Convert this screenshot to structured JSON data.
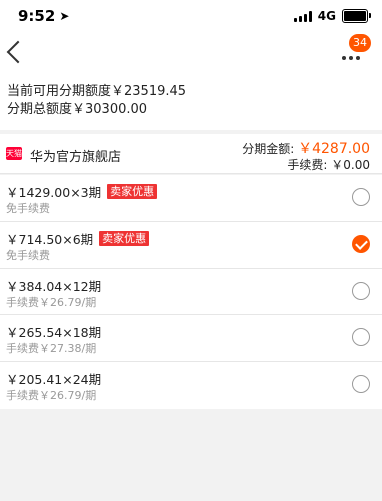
{
  "status_bar": {
    "time": "9:52",
    "network": "4G"
  },
  "nav": {
    "badge_count": "34"
  },
  "quota": {
    "available_line": "当前可用分期额度￥23519.45",
    "total_line": "分期总额度￥30300.00"
  },
  "store": {
    "logo_text": "天猫",
    "name": "华为官方旗舰店",
    "amount_label": "分期金额:",
    "amount_value": "￥4287.00",
    "fee_label": "手续费:",
    "fee_value": "￥0.00"
  },
  "plans": [
    {
      "main": "￥1429.00×3期",
      "promo": "卖家优惠",
      "sub": "免手续费",
      "selected": false
    },
    {
      "main": "￥714.50×6期",
      "promo": "卖家优惠",
      "sub": "免手续费",
      "selected": true
    },
    {
      "main": "￥384.04×12期",
      "promo": "",
      "sub": "手续费￥26.79/期",
      "selected": false
    },
    {
      "main": "￥265.54×18期",
      "promo": "",
      "sub": "手续费￥27.38/期",
      "selected": false
    },
    {
      "main": "￥205.41×24期",
      "promo": "",
      "sub": "手续费￥26.79/期",
      "selected": false
    }
  ],
  "colors": {
    "accent": "#ff5500",
    "promo": "#ee3333",
    "tmall": "#ff0036"
  }
}
